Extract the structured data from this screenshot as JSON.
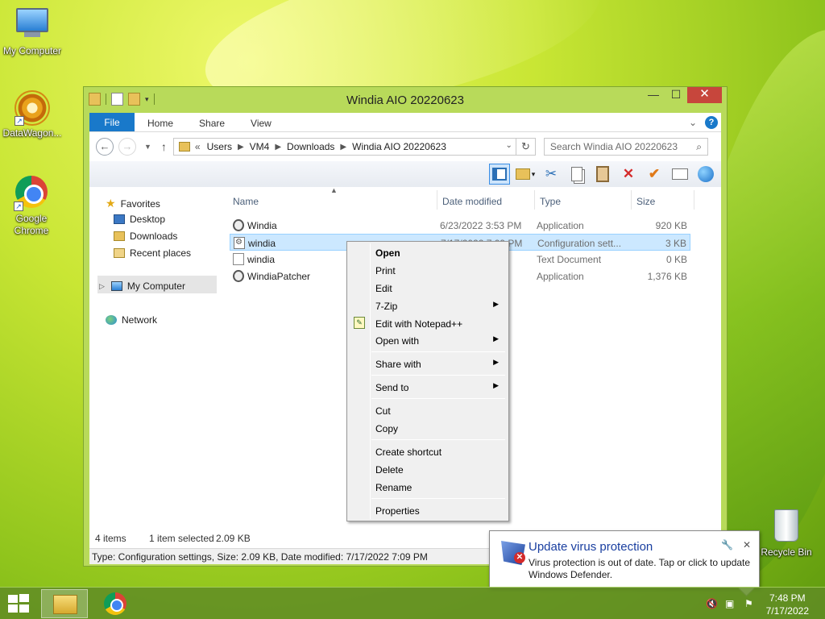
{
  "desktop": {
    "icons": [
      {
        "label": "My Computer"
      },
      {
        "label": "DataWagon..."
      },
      {
        "label": "Google Chrome"
      },
      {
        "label": "Recycle Bin"
      }
    ]
  },
  "window": {
    "title": "Windia AIO 20220623",
    "controls": {
      "minimize": "—",
      "maximize": "☐",
      "close": "✕"
    },
    "ribbon": {
      "file": "File",
      "tabs": [
        "Home",
        "Share",
        "View"
      ],
      "help": "?"
    },
    "address": {
      "back": "←",
      "forward": "→",
      "recent": "▼",
      "up": "↑",
      "overflow": "«",
      "crumbs": [
        "Users",
        "VM4",
        "Downloads",
        "Windia AIO 20220623"
      ],
      "refresh": "↻",
      "search_placeholder": "Search Windia AIO 20220623"
    },
    "nav": {
      "favorites": "Favorites",
      "desktop": "Desktop",
      "downloads": "Downloads",
      "recent": "Recent places",
      "computer": "My Computer",
      "network": "Network"
    },
    "columns": {
      "name": "Name",
      "date": "Date modified",
      "type": "Type",
      "size": "Size"
    },
    "files": [
      {
        "name": "Windia",
        "date": "6/23/2022 3:53 PM",
        "type": "Application",
        "size": "920 KB",
        "icon": "app-icon"
      },
      {
        "name": "windia",
        "date": "7/17/2022 7:09 PM",
        "type": "Configuration sett...",
        "size": "3 KB",
        "icon": "config-file-icon"
      },
      {
        "name": "windia",
        "date": "PM",
        "type": "Text Document",
        "size": "0 KB",
        "icon": "text-file-icon"
      },
      {
        "name": "WindiaPatcher",
        "date": "PM",
        "type": "Application",
        "size": "1,376 KB",
        "icon": "app-icon"
      }
    ],
    "status": {
      "count": "4 items",
      "selected": "1 item selected",
      "selsize": "2.09 KB"
    },
    "infobar": "Type: Configuration settings, Size: 2.09 KB, Date modified: 7/17/2022 7:09 PM"
  },
  "context_menu": {
    "open": "Open",
    "print": "Print",
    "edit": "Edit",
    "zip": "7-Zip",
    "notepad": "Edit with Notepad++",
    "open_with": "Open with",
    "share_with": "Share with",
    "send_to": "Send to",
    "cut": "Cut",
    "copy": "Copy",
    "shortcut": "Create shortcut",
    "delete": "Delete",
    "rename": "Rename",
    "properties": "Properties",
    "submenu_arrow": "▶"
  },
  "notification": {
    "title": "Update virus protection",
    "body": "Virus protection is out of date. Tap or click to update Windows Defender."
  },
  "taskbar": {
    "time": "7:48 PM",
    "date": "7/17/2022"
  },
  "colors": {
    "accent": "#1979ca",
    "window_frame": "#b8da5a",
    "close": "#c7463c"
  }
}
